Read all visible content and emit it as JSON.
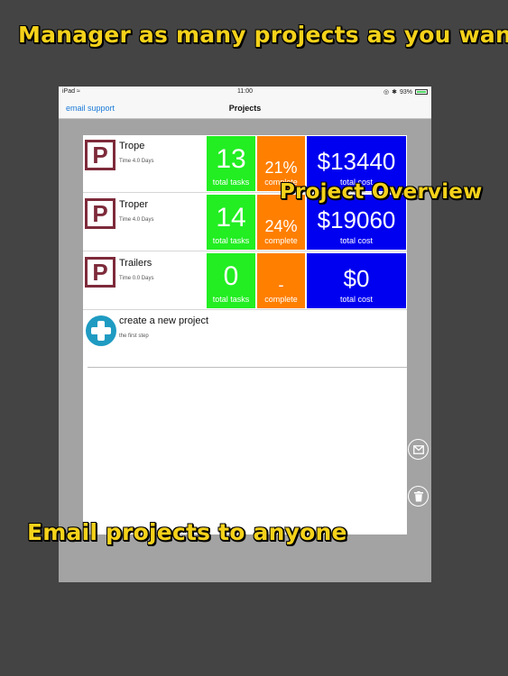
{
  "captions": {
    "top": "Manager as many projects as you want",
    "overview": "Project Overview",
    "email": "Email projects to anyone"
  },
  "status_bar": {
    "device": "iPad",
    "time": "11:00",
    "battery": "93%"
  },
  "nav": {
    "left_button": "email support",
    "title": "Projects"
  },
  "projects": [
    {
      "name": "Trope",
      "time": "Time 4.0 Days",
      "tasks": "13",
      "tasks_label": "total tasks",
      "percent": "21%",
      "percent_label": "complete",
      "cost": "$13440",
      "cost_label": "total cost"
    },
    {
      "name": "Troper",
      "time": "Time 4.0 Days",
      "tasks": "14",
      "tasks_label": "total tasks",
      "percent": "24%",
      "percent_label": "complete",
      "cost": "$19060",
      "cost_label": "total cost"
    },
    {
      "name": "Trailers",
      "time": "Time 0.0 Days",
      "tasks": "0",
      "tasks_label": "total tasks",
      "percent": "-",
      "percent_label": "complete",
      "cost": "$0",
      "cost_label": "total cost"
    }
  ],
  "new_project": {
    "title": "create a new project",
    "subtitle": "the first step"
  },
  "logo_letter": "P",
  "colors": {
    "caption": "#f5d21a",
    "tasks_tile": "#22ee22",
    "percent_tile": "#ff7f00",
    "cost_tile": "#0000f0",
    "logo": "#7d2a3a",
    "new_icon": "#1f9bc2",
    "link": "#1a7ad8"
  },
  "icons": {
    "mail": "mail-icon",
    "trash": "trash-icon",
    "plus": "plus-icon",
    "wifi": "wifi-icon"
  }
}
